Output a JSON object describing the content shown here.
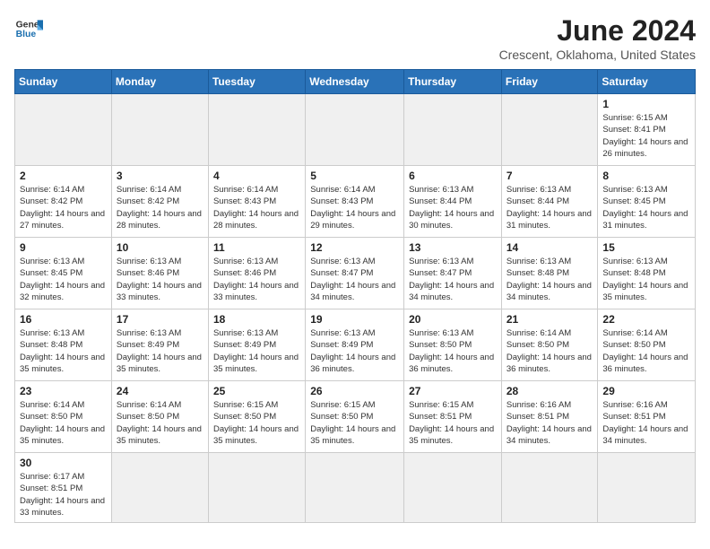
{
  "header": {
    "logo_line1": "General",
    "logo_line2": "Blue",
    "month": "June 2024",
    "location": "Crescent, Oklahoma, United States"
  },
  "weekdays": [
    "Sunday",
    "Monday",
    "Tuesday",
    "Wednesday",
    "Thursday",
    "Friday",
    "Saturday"
  ],
  "weeks": [
    [
      {
        "day": "",
        "info": ""
      },
      {
        "day": "",
        "info": ""
      },
      {
        "day": "",
        "info": ""
      },
      {
        "day": "",
        "info": ""
      },
      {
        "day": "",
        "info": ""
      },
      {
        "day": "",
        "info": ""
      },
      {
        "day": "1",
        "info": "Sunrise: 6:15 AM\nSunset: 8:41 PM\nDaylight: 14 hours and 26 minutes."
      }
    ],
    [
      {
        "day": "2",
        "info": "Sunrise: 6:14 AM\nSunset: 8:42 PM\nDaylight: 14 hours and 27 minutes."
      },
      {
        "day": "3",
        "info": "Sunrise: 6:14 AM\nSunset: 8:42 PM\nDaylight: 14 hours and 28 minutes."
      },
      {
        "day": "4",
        "info": "Sunrise: 6:14 AM\nSunset: 8:43 PM\nDaylight: 14 hours and 28 minutes."
      },
      {
        "day": "5",
        "info": "Sunrise: 6:14 AM\nSunset: 8:43 PM\nDaylight: 14 hours and 29 minutes."
      },
      {
        "day": "6",
        "info": "Sunrise: 6:13 AM\nSunset: 8:44 PM\nDaylight: 14 hours and 30 minutes."
      },
      {
        "day": "7",
        "info": "Sunrise: 6:13 AM\nSunset: 8:44 PM\nDaylight: 14 hours and 31 minutes."
      },
      {
        "day": "8",
        "info": "Sunrise: 6:13 AM\nSunset: 8:45 PM\nDaylight: 14 hours and 31 minutes."
      }
    ],
    [
      {
        "day": "9",
        "info": "Sunrise: 6:13 AM\nSunset: 8:45 PM\nDaylight: 14 hours and 32 minutes."
      },
      {
        "day": "10",
        "info": "Sunrise: 6:13 AM\nSunset: 8:46 PM\nDaylight: 14 hours and 33 minutes."
      },
      {
        "day": "11",
        "info": "Sunrise: 6:13 AM\nSunset: 8:46 PM\nDaylight: 14 hours and 33 minutes."
      },
      {
        "day": "12",
        "info": "Sunrise: 6:13 AM\nSunset: 8:47 PM\nDaylight: 14 hours and 34 minutes."
      },
      {
        "day": "13",
        "info": "Sunrise: 6:13 AM\nSunset: 8:47 PM\nDaylight: 14 hours and 34 minutes."
      },
      {
        "day": "14",
        "info": "Sunrise: 6:13 AM\nSunset: 8:48 PM\nDaylight: 14 hours and 34 minutes."
      },
      {
        "day": "15",
        "info": "Sunrise: 6:13 AM\nSunset: 8:48 PM\nDaylight: 14 hours and 35 minutes."
      }
    ],
    [
      {
        "day": "16",
        "info": "Sunrise: 6:13 AM\nSunset: 8:48 PM\nDaylight: 14 hours and 35 minutes."
      },
      {
        "day": "17",
        "info": "Sunrise: 6:13 AM\nSunset: 8:49 PM\nDaylight: 14 hours and 35 minutes."
      },
      {
        "day": "18",
        "info": "Sunrise: 6:13 AM\nSunset: 8:49 PM\nDaylight: 14 hours and 35 minutes."
      },
      {
        "day": "19",
        "info": "Sunrise: 6:13 AM\nSunset: 8:49 PM\nDaylight: 14 hours and 36 minutes."
      },
      {
        "day": "20",
        "info": "Sunrise: 6:13 AM\nSunset: 8:50 PM\nDaylight: 14 hours and 36 minutes."
      },
      {
        "day": "21",
        "info": "Sunrise: 6:14 AM\nSunset: 8:50 PM\nDaylight: 14 hours and 36 minutes."
      },
      {
        "day": "22",
        "info": "Sunrise: 6:14 AM\nSunset: 8:50 PM\nDaylight: 14 hours and 36 minutes."
      }
    ],
    [
      {
        "day": "23",
        "info": "Sunrise: 6:14 AM\nSunset: 8:50 PM\nDaylight: 14 hours and 35 minutes."
      },
      {
        "day": "24",
        "info": "Sunrise: 6:14 AM\nSunset: 8:50 PM\nDaylight: 14 hours and 35 minutes."
      },
      {
        "day": "25",
        "info": "Sunrise: 6:15 AM\nSunset: 8:50 PM\nDaylight: 14 hours and 35 minutes."
      },
      {
        "day": "26",
        "info": "Sunrise: 6:15 AM\nSunset: 8:50 PM\nDaylight: 14 hours and 35 minutes."
      },
      {
        "day": "27",
        "info": "Sunrise: 6:15 AM\nSunset: 8:51 PM\nDaylight: 14 hours and 35 minutes."
      },
      {
        "day": "28",
        "info": "Sunrise: 6:16 AM\nSunset: 8:51 PM\nDaylight: 14 hours and 34 minutes."
      },
      {
        "day": "29",
        "info": "Sunrise: 6:16 AM\nSunset: 8:51 PM\nDaylight: 14 hours and 34 minutes."
      }
    ],
    [
      {
        "day": "30",
        "info": "Sunrise: 6:17 AM\nSunset: 8:51 PM\nDaylight: 14 hours and 33 minutes."
      },
      {
        "day": "",
        "info": ""
      },
      {
        "day": "",
        "info": ""
      },
      {
        "day": "",
        "info": ""
      },
      {
        "day": "",
        "info": ""
      },
      {
        "day": "",
        "info": ""
      },
      {
        "day": "",
        "info": ""
      }
    ]
  ]
}
